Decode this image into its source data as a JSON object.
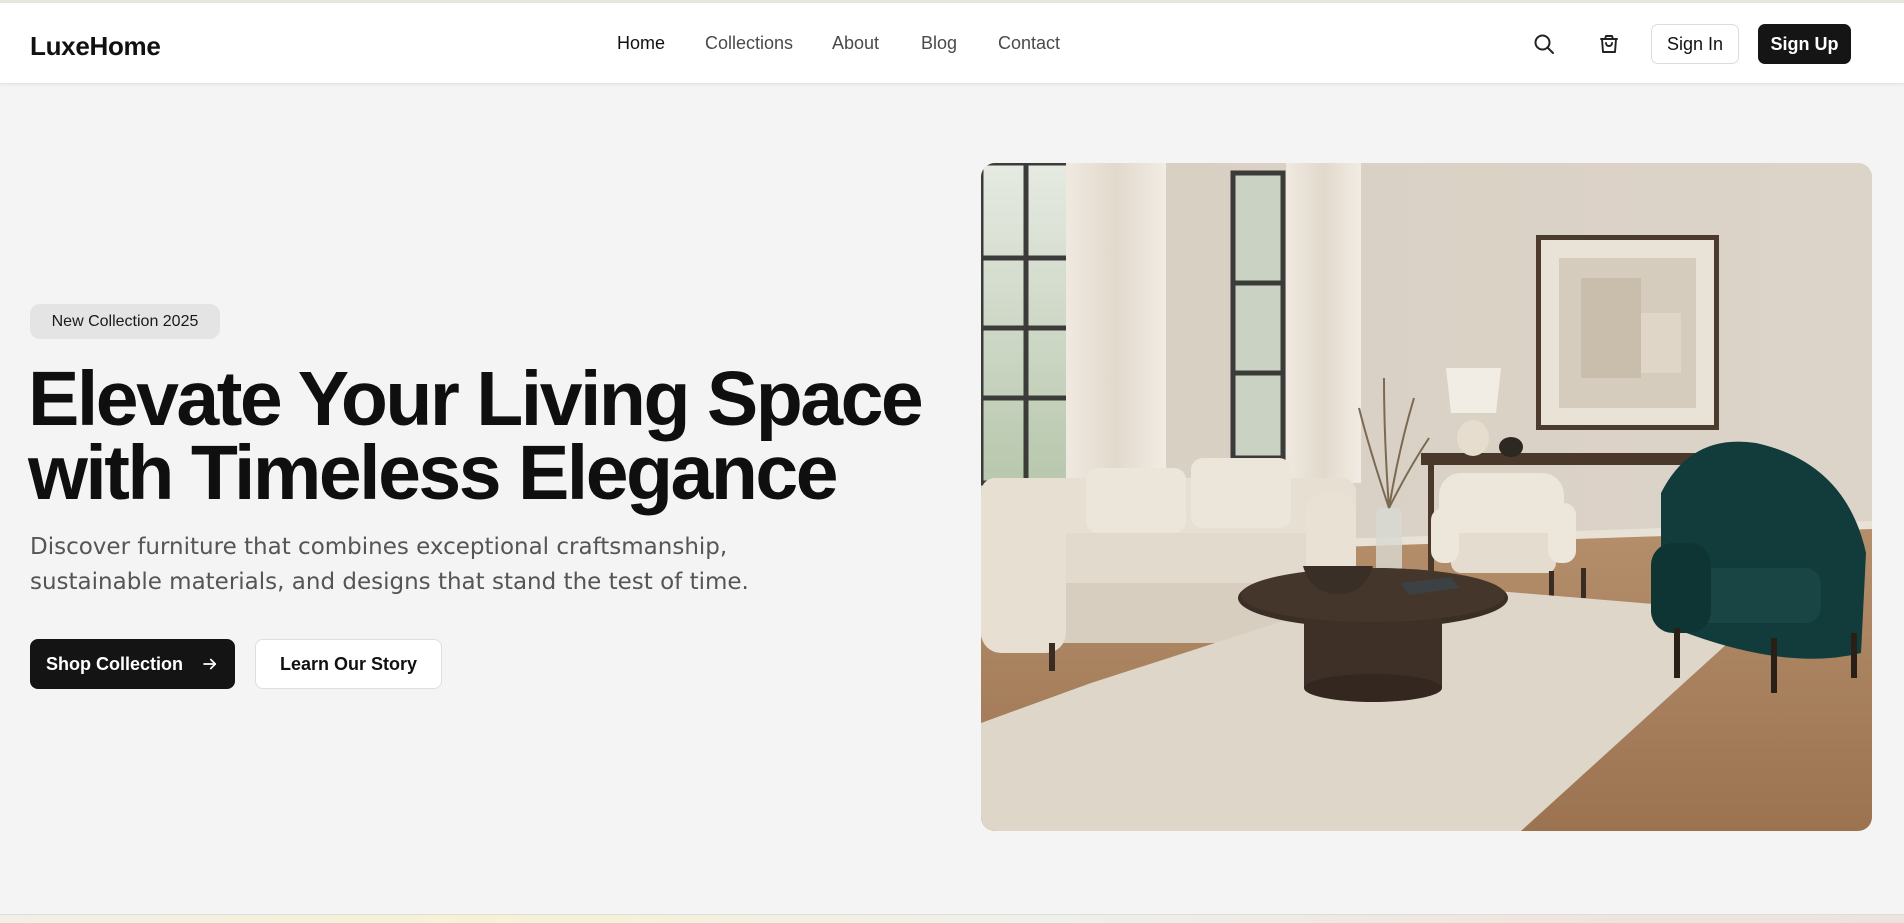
{
  "brand": {
    "name": "LuxeHome"
  },
  "nav": {
    "links": [
      {
        "label": "Home",
        "active": true
      },
      {
        "label": "Collections",
        "active": false
      },
      {
        "label": "About",
        "active": false
      },
      {
        "label": "Blog",
        "active": false
      },
      {
        "label": "Contact",
        "active": false
      }
    ]
  },
  "header_actions": {
    "search_icon": "search-icon",
    "cart_icon": "shopping-bag-icon",
    "sign_in_label": "Sign In",
    "sign_up_label": "Sign Up"
  },
  "hero": {
    "badge": "New Collection 2025",
    "headline_line1": "Elevate Your Living Space",
    "headline_line2": "with Timeless Elegance",
    "subtext_line1": "Discover furniture that combines exceptional craftsmanship,",
    "subtext_line2": "sustainable materials, and designs that stand the test of time.",
    "primary_cta": "Shop Collection",
    "primary_cta_icon": "arrow-right-icon",
    "secondary_cta": "Learn Our Story"
  },
  "colors": {
    "page_bg": "#f4f4f4",
    "header_bg": "#ffffff",
    "dark_button": "#141414",
    "badge_bg": "#e4e4e4",
    "muted_text": "#555555"
  }
}
